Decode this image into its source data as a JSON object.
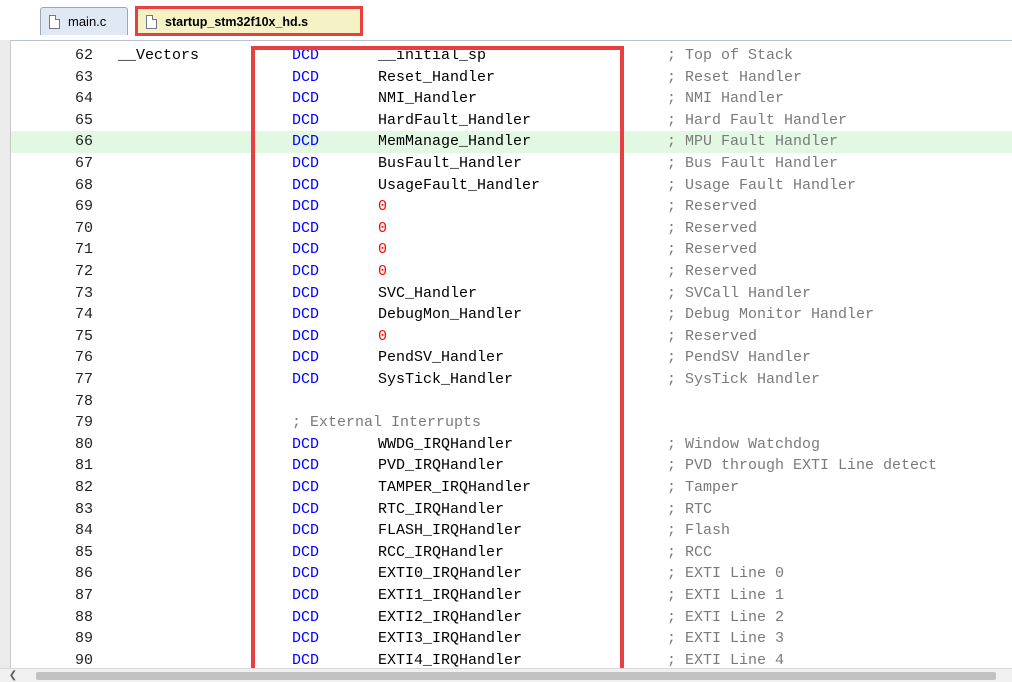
{
  "tabs": [
    {
      "label": "main.c",
      "active": false
    },
    {
      "label": "startup_stm32f10x_hd.s",
      "active": true
    }
  ],
  "colors": {
    "keyword": "#0000ff",
    "number": "#ff0000",
    "comment": "#7a7a7a",
    "current_line": "#e3f8e3",
    "annotation_box": "#e84040"
  },
  "current_line": 66,
  "lines": [
    {
      "n": "62",
      "label": "__Vectors",
      "kw": "DCD",
      "op": "__initial_sp",
      "cmt": "; Top of Stack"
    },
    {
      "n": "63",
      "kw": "DCD",
      "op": "Reset_Handler",
      "cmt": "; Reset Handler"
    },
    {
      "n": "64",
      "kw": "DCD",
      "op": "NMI_Handler",
      "cmt": "; NMI Handler"
    },
    {
      "n": "65",
      "kw": "DCD",
      "op": "HardFault_Handler",
      "cmt": "; Hard Fault Handler"
    },
    {
      "n": "66",
      "kw": "DCD",
      "op": "MemManage_Handler",
      "cmt": "; MPU Fault Handler"
    },
    {
      "n": "67",
      "kw": "DCD",
      "op": "BusFault_Handler",
      "cmt": "; Bus Fault Handler"
    },
    {
      "n": "68",
      "kw": "DCD",
      "op": "UsageFault_Handler",
      "cmt": "; Usage Fault Handler"
    },
    {
      "n": "69",
      "kw": "DCD",
      "op": "0",
      "num": true,
      "cmt": "; Reserved"
    },
    {
      "n": "70",
      "kw": "DCD",
      "op": "0",
      "num": true,
      "cmt": "; Reserved"
    },
    {
      "n": "71",
      "kw": "DCD",
      "op": "0",
      "num": true,
      "cmt": "; Reserved"
    },
    {
      "n": "72",
      "kw": "DCD",
      "op": "0",
      "num": true,
      "cmt": "; Reserved"
    },
    {
      "n": "73",
      "kw": "DCD",
      "op": "SVC_Handler",
      "cmt": "; SVCall Handler"
    },
    {
      "n": "74",
      "kw": "DCD",
      "op": "DebugMon_Handler",
      "cmt": "; Debug Monitor Handler"
    },
    {
      "n": "75",
      "kw": "DCD",
      "op": "0",
      "num": true,
      "cmt": "; Reserved"
    },
    {
      "n": "76",
      "kw": "DCD",
      "op": "PendSV_Handler",
      "cmt": "; PendSV Handler"
    },
    {
      "n": "77",
      "kw": "DCD",
      "op": "SysTick_Handler",
      "cmt": "; SysTick Handler"
    },
    {
      "n": "78"
    },
    {
      "n": "79",
      "full_cmt": "; External Interrupts"
    },
    {
      "n": "80",
      "kw": "DCD",
      "op": "WWDG_IRQHandler",
      "cmt": "; Window Watchdog"
    },
    {
      "n": "81",
      "kw": "DCD",
      "op": "PVD_IRQHandler",
      "cmt": "; PVD through EXTI Line detect"
    },
    {
      "n": "82",
      "kw": "DCD",
      "op": "TAMPER_IRQHandler",
      "cmt": "; Tamper"
    },
    {
      "n": "83",
      "kw": "DCD",
      "op": "RTC_IRQHandler",
      "cmt": "; RTC"
    },
    {
      "n": "84",
      "kw": "DCD",
      "op": "FLASH_IRQHandler",
      "cmt": "; Flash"
    },
    {
      "n": "85",
      "kw": "DCD",
      "op": "RCC_IRQHandler",
      "cmt": "; RCC"
    },
    {
      "n": "86",
      "kw": "DCD",
      "op": "EXTI0_IRQHandler",
      "cmt": "; EXTI Line 0"
    },
    {
      "n": "87",
      "kw": "DCD",
      "op": "EXTI1_IRQHandler",
      "cmt": "; EXTI Line 1"
    },
    {
      "n": "88",
      "kw": "DCD",
      "op": "EXTI2_IRQHandler",
      "cmt": "; EXTI Line 2"
    },
    {
      "n": "89",
      "kw": "DCD",
      "op": "EXTI3_IRQHandler",
      "cmt": "; EXTI Line 3"
    },
    {
      "n": "90",
      "kw": "DCD",
      "op": "EXTI4_IRQHandler",
      "cmt": "; EXTI Line 4"
    }
  ]
}
